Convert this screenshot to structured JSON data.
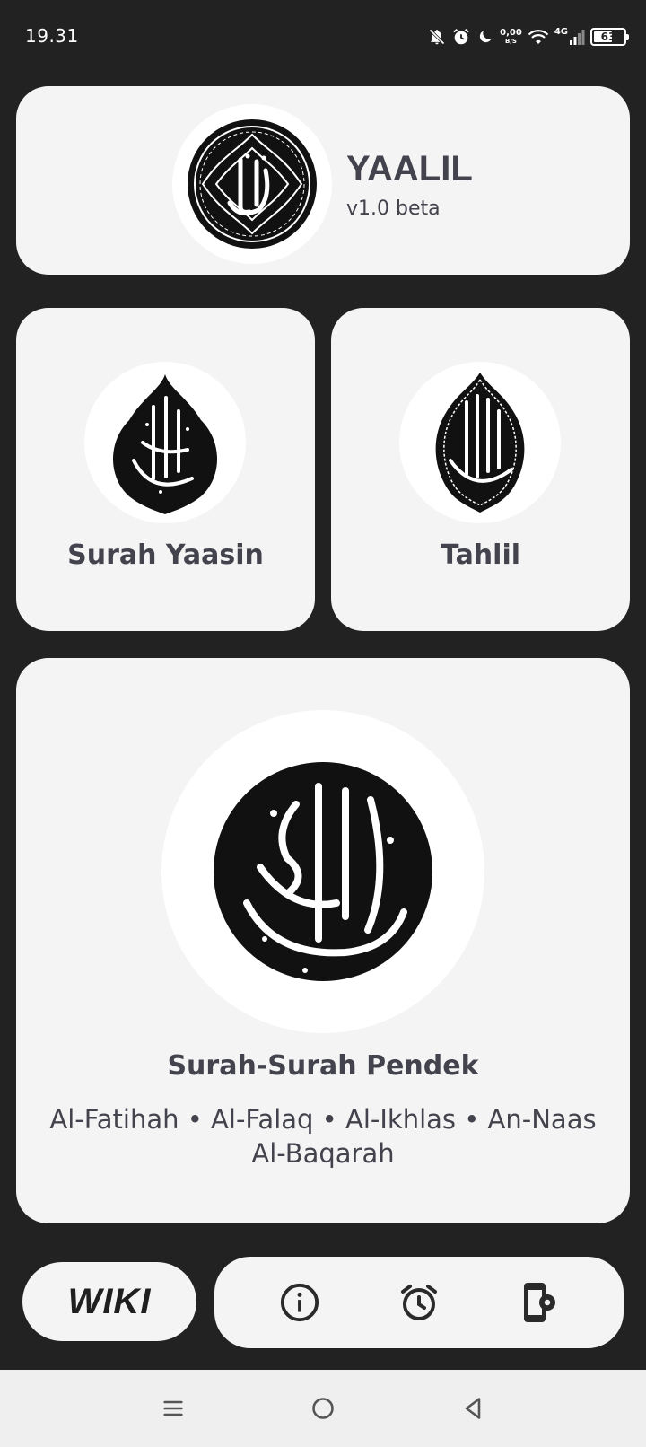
{
  "status_bar": {
    "time": "19.31",
    "net_speed_value": "0,00",
    "net_speed_unit": "B/S",
    "network": "4G",
    "battery": "63",
    "battery_level": 0.63,
    "icons": [
      "bell-off-icon",
      "alarm-icon",
      "moon-icon",
      "wifi-icon",
      "signal-icon",
      "battery-icon"
    ]
  },
  "header": {
    "app_name": "YAALIL",
    "version": "v1.0 beta",
    "logo": "calligraphy-logo"
  },
  "cards": {
    "yaasin": {
      "title": "Surah Yaasin",
      "image": "calligraphy-teardrop"
    },
    "tahlil": {
      "title": "Tahlil",
      "image": "calligraphy-ornate"
    },
    "pendek": {
      "title": "Surah-Surah Pendek",
      "surahs_line1": "Al-Fatihah • Al-Falaq • Al-Ikhlas • An-Naas",
      "surahs_line2": "Al-Baqarah",
      "image": "calligraphy-round"
    }
  },
  "bottom_bar": {
    "wiki_label": "WIKI",
    "buttons": [
      "info-icon",
      "alarm-clock-icon",
      "app-settings-icon"
    ]
  },
  "nav_bar": {
    "buttons": [
      "menu-icon",
      "home-icon",
      "back-icon"
    ]
  },
  "colors": {
    "background": "#222222",
    "card": "#f4f4f4",
    "text": "#43434d"
  }
}
